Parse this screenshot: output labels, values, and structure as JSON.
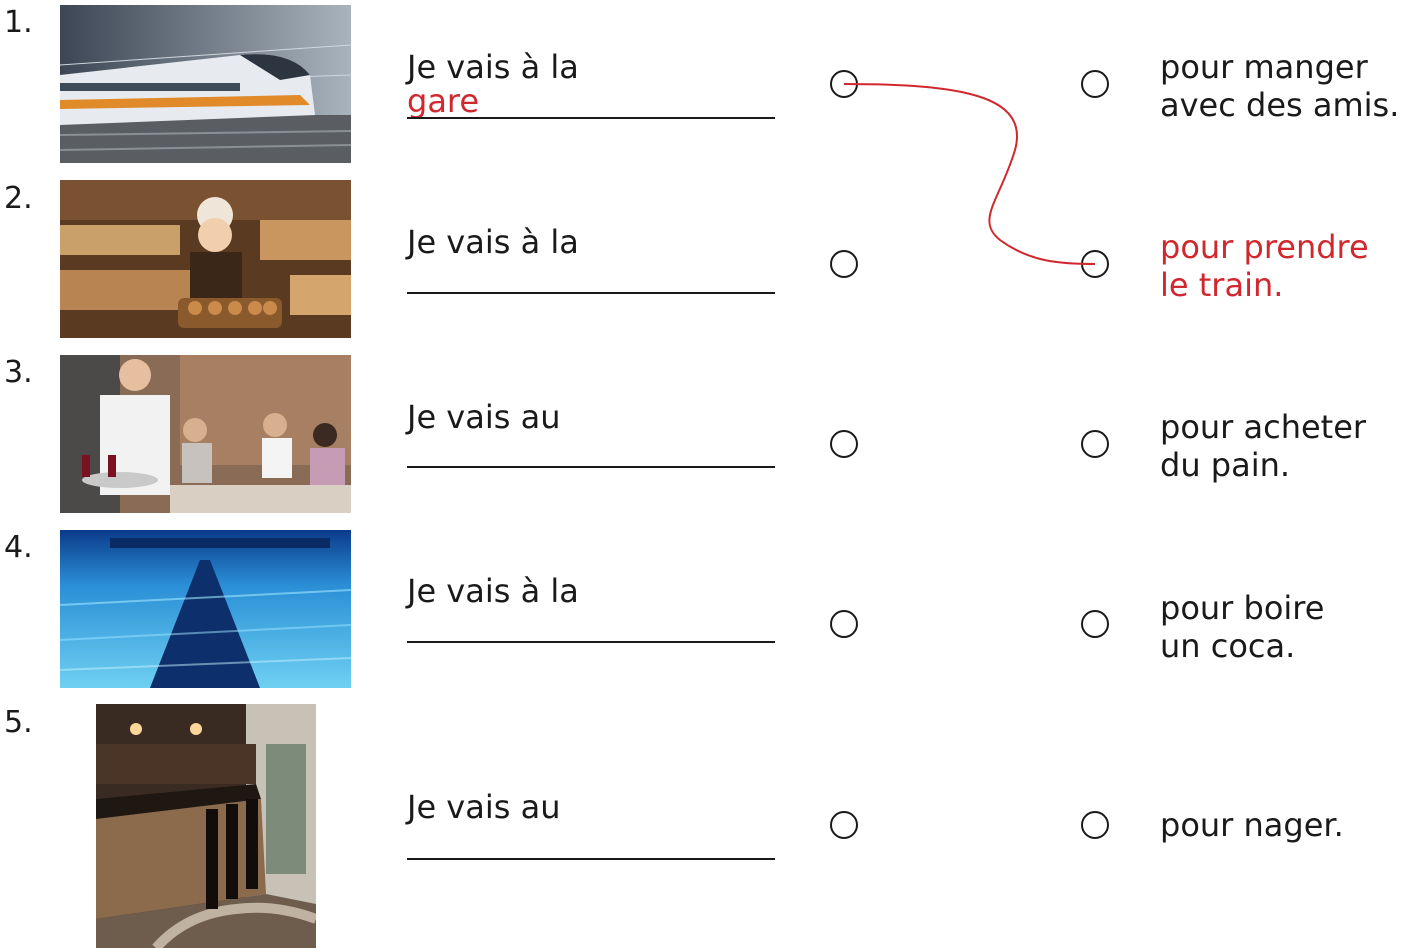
{
  "colors": {
    "answer": "#d0282e",
    "ink": "#1a1a1a"
  },
  "items": [
    {
      "number": "1.",
      "image": "high-speed train",
      "prompt": "Je vais à la",
      "answer": "gare"
    },
    {
      "number": "2.",
      "image": "bakery with baker holding bread tray",
      "prompt": "Je vais à la",
      "answer": ""
    },
    {
      "number": "3.",
      "image": "restaurant waiter serving wine",
      "prompt": "Je vais au",
      "answer": ""
    },
    {
      "number": "4.",
      "image": "swimming pool lane underwater",
      "prompt": "Je vais à la",
      "answer": ""
    },
    {
      "number": "5.",
      "image": "café bar counter with stools",
      "prompt": "Je vais au",
      "answer": ""
    }
  ],
  "choices": [
    {
      "line1": "pour manger",
      "line2": "avec des amis.",
      "selected": false
    },
    {
      "line1": "pour prendre",
      "line2": "le train.",
      "selected": true
    },
    {
      "line1": "pour acheter",
      "line2": "du pain.",
      "selected": false
    },
    {
      "line1": "pour boire",
      "line2": "un coca.",
      "selected": false
    },
    {
      "line1": "pour nager.",
      "line2": "",
      "selected": false
    }
  ],
  "connections": [
    {
      "from_item": 1,
      "to_choice": 2
    }
  ]
}
